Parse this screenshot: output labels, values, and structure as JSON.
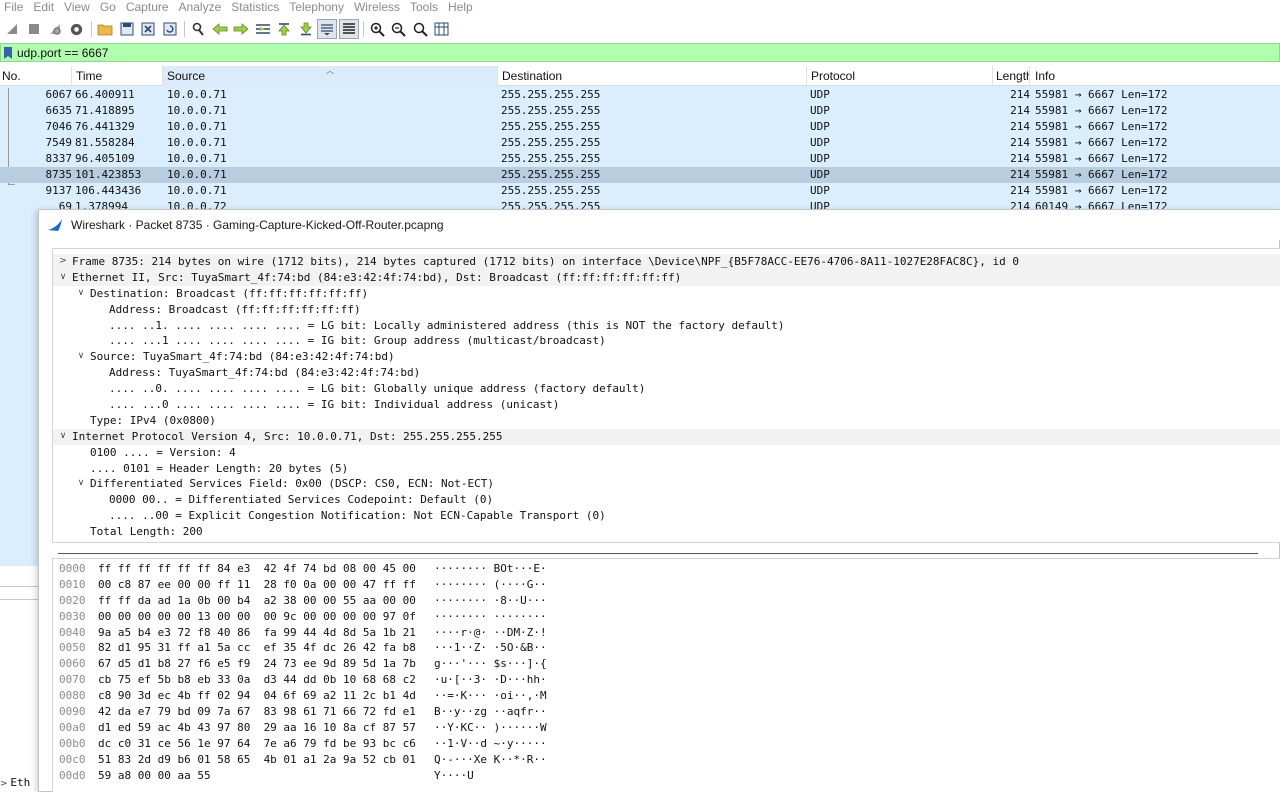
{
  "menu": [
    "File",
    "Edit",
    "View",
    "Go",
    "Capture",
    "Analyze",
    "Statistics",
    "Telephony",
    "Wireless",
    "Tools",
    "Help"
  ],
  "toolbar": [
    "shark-fin-start-icon",
    "stop-square-icon",
    "restart-icon",
    "gear-options-icon",
    "open-folder-icon",
    "save-file-icon",
    "close-file-icon",
    "reload-file-icon",
    "find-packet-icon",
    "go-back-icon",
    "go-forward-icon",
    "go-to-packet-icon",
    "go-first-icon",
    "go-last-icon",
    "autoscroll-icon",
    "colorize-icon",
    "zoom-in-icon",
    "zoom-out-icon",
    "zoom-normal-icon",
    "resize-columns-icon"
  ],
  "filter": {
    "value": "udp.port == 6667"
  },
  "packet_list": {
    "columns": [
      "No.",
      "Time",
      "Source",
      "Destination",
      "Protocol",
      "Length",
      "Info"
    ],
    "rows": [
      [
        "6067",
        "66.400911",
        "10.0.0.71",
        "255.255.255.255",
        "UDP",
        "214",
        "55981 → 6667 Len=172"
      ],
      [
        "6635",
        "71.418895",
        "10.0.0.71",
        "255.255.255.255",
        "UDP",
        "214",
        "55981 → 6667 Len=172"
      ],
      [
        "7046",
        "76.441329",
        "10.0.0.71",
        "255.255.255.255",
        "UDP",
        "214",
        "55981 → 6667 Len=172"
      ],
      [
        "7549",
        "81.558284",
        "10.0.0.71",
        "255.255.255.255",
        "UDP",
        "214",
        "55981 → 6667 Len=172"
      ],
      [
        "8337",
        "96.405109",
        "10.0.0.71",
        "255.255.255.255",
        "UDP",
        "214",
        "55981 → 6667 Len=172"
      ],
      [
        "8735",
        "101.423853",
        "10.0.0.71",
        "255.255.255.255",
        "UDP",
        "214",
        "55981 → 6667 Len=172"
      ],
      [
        "9137",
        "106.443436",
        "10.0.0.71",
        "255.255.255.255",
        "UDP",
        "214",
        "55981 → 6667 Len=172"
      ],
      [
        "69",
        "1.378994",
        "10.0.0.72",
        "255.255.255.255",
        "UDP",
        "214",
        "60149 → 6667 Len=172"
      ]
    ]
  },
  "dialog": {
    "title": "Wireshark · Packet 8735 · Gaming-Capture-Kicked-Off-Router.pcapng",
    "details": [
      {
        "text": "Frame 8735: 214 bytes on wire (1712 bits), 214 bytes captured (1712 bits) on interface \\Device\\NPF_{B5F78ACC-EE76-4706-8A11-1027E28FAC8C}, id 0",
        "state": "collapsed",
        "indent": 0
      },
      {
        "text": "Ethernet II, Src: TuyaSmart_4f:74:bd (84:e3:42:4f:74:bd), Dst: Broadcast (ff:ff:ff:ff:ff:ff)",
        "state": "expanded",
        "indent": 0
      },
      {
        "text": "Destination: Broadcast (ff:ff:ff:ff:ff:ff)",
        "state": "expanded",
        "indent": 1
      },
      {
        "text": "Address: Broadcast (ff:ff:ff:ff:ff:ff)",
        "state": "",
        "indent": 2
      },
      {
        "text": ".... ..1. .... .... .... .... = LG bit: Locally administered address (this is NOT the factory default)",
        "state": "",
        "indent": 2
      },
      {
        "text": ".... ...1 .... .... .... .... = IG bit: Group address (multicast/broadcast)",
        "state": "",
        "indent": 2
      },
      {
        "text": "Source: TuyaSmart_4f:74:bd (84:e3:42:4f:74:bd)",
        "state": "expanded",
        "indent": 1
      },
      {
        "text": "Address: TuyaSmart_4f:74:bd (84:e3:42:4f:74:bd)",
        "state": "",
        "indent": 2
      },
      {
        "text": ".... ..0. .... .... .... .... = LG bit: Globally unique address (factory default)",
        "state": "",
        "indent": 2
      },
      {
        "text": ".... ...0 .... .... .... .... = IG bit: Individual address (unicast)",
        "state": "",
        "indent": 2
      },
      {
        "text": "Type: IPv4 (0x0800)",
        "state": "",
        "indent": 1
      },
      {
        "text": "Internet Protocol Version 4, Src: 10.0.0.71, Dst: 255.255.255.255",
        "state": "expanded",
        "indent": 0
      },
      {
        "text": "0100 .... = Version: 4",
        "state": "",
        "indent": 1
      },
      {
        "text": ".... 0101 = Header Length: 20 bytes (5)",
        "state": "",
        "indent": 1
      },
      {
        "text": "Differentiated Services Field: 0x00 (DSCP: CS0, ECN: Not-ECT)",
        "state": "expanded",
        "indent": 1
      },
      {
        "text": "0000 00.. = Differentiated Services Codepoint: Default (0)",
        "state": "",
        "indent": 2
      },
      {
        "text": ".... ..00 = Explicit Congestion Notification: Not ECN-Capable Transport (0)",
        "state": "",
        "indent": 2
      },
      {
        "text": "Total Length: 200",
        "state": "",
        "indent": 1
      }
    ],
    "bytes": [
      [
        "0000",
        "ff ff ff ff ff ff 84 e3  42 4f 74 bd 08 00 45 00",
        "········ BOt···E·"
      ],
      [
        "0010",
        "00 c8 87 ee 00 00 ff 11  28 f0 0a 00 00 47 ff ff",
        "········ (····G··"
      ],
      [
        "0020",
        "ff ff da ad 1a 0b 00 b4  a2 38 00 00 55 aa 00 00",
        "········ ·8··U···"
      ],
      [
        "0030",
        "00 00 00 00 00 13 00 00  00 9c 00 00 00 00 97 0f",
        "········ ········"
      ],
      [
        "0040",
        "9a a5 b4 e3 72 f8 40 86  fa 99 44 4d 8d 5a 1b 21",
        "····r·@· ··DM·Z·!"
      ],
      [
        "0050",
        "82 d1 95 31 ff a1 5a cc  ef 35 4f dc 26 42 fa b8",
        "···1··Z· ·5O·&B··"
      ],
      [
        "0060",
        "67 d5 d1 b8 27 f6 e5 f9  24 73 ee 9d 89 5d 1a 7b",
        "g···'··· $s···]·{"
      ],
      [
        "0070",
        "cb 75 ef 5b b8 eb 33 0a  d3 44 dd 0b 10 68 68 c2",
        "·u·[··3· ·D···hh·"
      ],
      [
        "0080",
        "c8 90 3d ec 4b ff 02 94  04 6f 69 a2 11 2c b1 4d",
        "··=·K··· ·oi··,·M"
      ],
      [
        "0090",
        "42 da e7 79 bd 09 7a 67  83 98 61 71 66 72 fd e1",
        "B··y··zg ··aqfr··"
      ],
      [
        "00a0",
        "d1 ed 59 ac 4b 43 97 80  29 aa 16 10 8a cf 87 57",
        "··Y·KC·· )······W"
      ],
      [
        "00b0",
        "dc c0 31 ce 56 1e 97 64  7e a6 79 fd be 93 bc c6",
        "··1·V··d ~·y·····"
      ],
      [
        "00c0",
        "51 83 2d d9 b6 01 58 65  4b 01 a1 2a 9a 52 cb 01",
        "Q·-···Xe K··*·R··"
      ],
      [
        "00d0",
        "59 a8 00 00 aa 55",
        "Y····U"
      ]
    ]
  },
  "lower_left": {
    "text": "Eth"
  }
}
